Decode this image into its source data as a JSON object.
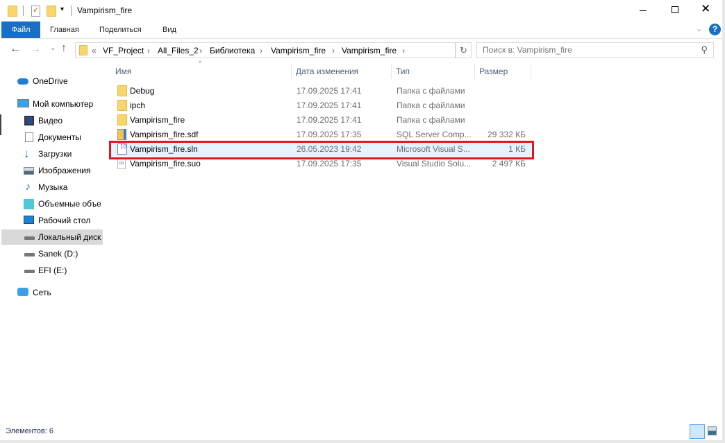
{
  "window": {
    "title": "Vampirism_fire"
  },
  "ribbon": {
    "tabs": [
      "Файл",
      "Главная",
      "Поделиться",
      "Вид"
    ]
  },
  "address": {
    "overflow": "«",
    "crumbs": [
      "VF_Project",
      "All_Files_2",
      "Библиотека",
      "Vampirism_fire",
      "Vampirism_fire"
    ]
  },
  "search": {
    "placeholder": "Поиск в: Vampirism_fire"
  },
  "nav": {
    "items": [
      "OneDrive",
      "Мой компьютер",
      "Видео",
      "Документы",
      "Загрузки",
      "Изображения",
      "Музыка",
      "Объемные объекты",
      "Рабочий стол",
      "Локальный диск",
      "Sanek (D:)",
      "EFI (E:)",
      "Сеть"
    ]
  },
  "columns": [
    "Имя",
    "Дата изменения",
    "Тип",
    "Размер"
  ],
  "files": [
    {
      "name": "Debug",
      "date": "17.09.2025 17:41",
      "type": "Папка с файлами",
      "size": ""
    },
    {
      "name": "ipch",
      "date": "17.09.2025 17:41",
      "type": "Папка с файлами",
      "size": ""
    },
    {
      "name": "Vampirism_fire",
      "date": "17.09.2025 17:41",
      "type": "Папка с файлами",
      "size": ""
    },
    {
      "name": "Vampirism_fire.sdf",
      "date": "17.09.2025 17:35",
      "type": "SQL Server Comp...",
      "size": "29 332 КБ"
    },
    {
      "name": "Vampirism_fire.sln",
      "date": "26.05.2023 19:42",
      "type": "Microsoft Visual S...",
      "size": "1 КБ"
    },
    {
      "name": "Vampirism_fire.suo",
      "date": "17.09.2025 17:35",
      "type": "Visual Studio Solu...",
      "size": "2 497 КБ"
    }
  ],
  "status": {
    "count": "Элементов: 6"
  },
  "colors": {
    "accent": "#1a6fc4",
    "highlight": "#e5f3ff",
    "annotation": "#e8141c"
  }
}
